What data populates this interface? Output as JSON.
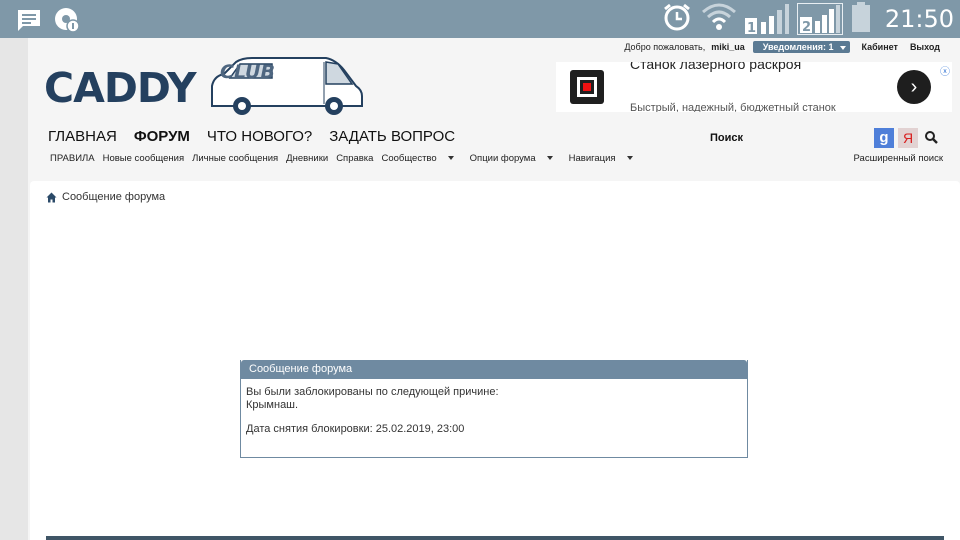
{
  "status_bar": {
    "time": "21:50",
    "sim1_label": "1",
    "sim2_label": "2",
    "icons": [
      "message-icon",
      "app-notification-icon",
      "alarm-icon",
      "wifi-icon",
      "signal-sim1-icon",
      "signal-sim2-icon",
      "battery-icon"
    ]
  },
  "header": {
    "welcome": "Добро пожаловать,",
    "username": "miki_ua",
    "notifications": "Уведомления: 1",
    "cabinet": "Кабинет",
    "logout": "Выход",
    "logo_text": "CADDY",
    "logo_club": "CLUB"
  },
  "ad": {
    "title": "Станок лазерного раскроя",
    "subtitle": "Быстрый, надежный, бюджетный станок"
  },
  "main_nav": [
    {
      "label": "ГЛАВНАЯ",
      "active": false
    },
    {
      "label": "ФОРУМ",
      "active": true
    },
    {
      "label": "ЧТО НОВОГО?",
      "active": false
    },
    {
      "label": "ЗАДАТЬ ВОПРОС",
      "active": false
    }
  ],
  "search": {
    "label": "Поиск",
    "google_label": "g",
    "yandex_label": "Я",
    "advanced": "Расширенный поиск"
  },
  "sub_nav": [
    {
      "label": "ПРАВИЛА",
      "dropdown": false
    },
    {
      "label": "Новые сообщения",
      "dropdown": false
    },
    {
      "label": "Личные сообщения",
      "dropdown": false
    },
    {
      "label": "Дневники",
      "dropdown": false
    },
    {
      "label": "Справка",
      "dropdown": false
    },
    {
      "label": "Сообщество",
      "dropdown": true
    },
    {
      "label": "Опции форума",
      "dropdown": true
    },
    {
      "label": "Навигация",
      "dropdown": true
    }
  ],
  "breadcrumb": "Сообщение форума",
  "message": {
    "title": "Сообщение форума",
    "line1": "Вы были заблокированы по следующей причине:",
    "reason": "Крымнаш.",
    "unban": "Дата снятия блокировки: 25.02.2019, 23:00"
  },
  "colors": {
    "status_bar": "#7f98a8",
    "logo": "#24405f",
    "box_header": "#6f8aa1"
  }
}
